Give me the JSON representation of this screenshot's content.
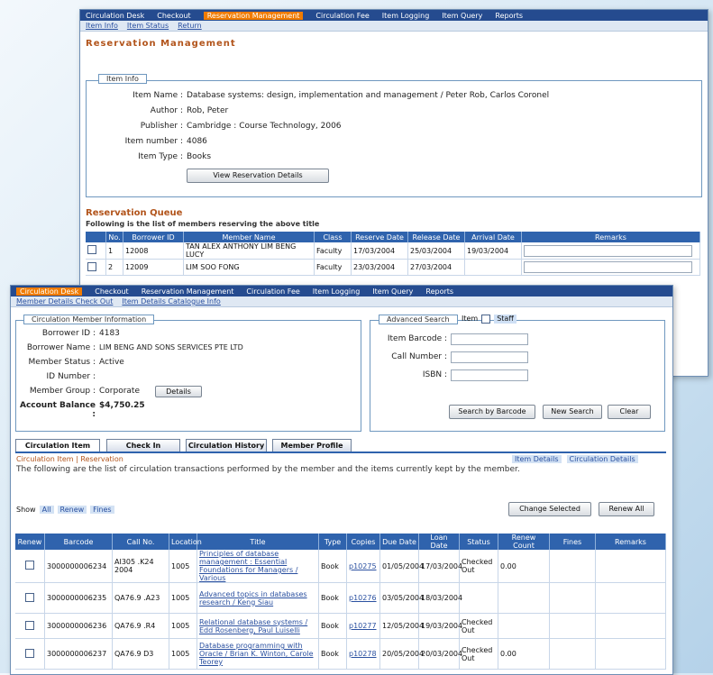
{
  "win1": {
    "nav": [
      "Circulation Desk",
      "Checkout",
      "Reservation Management",
      "Circulation Fee",
      "Item Logging",
      "Item Query",
      "Reports"
    ],
    "active_index": 2,
    "subnav": [
      "Item Info",
      "Item Status",
      "Return"
    ],
    "title": "Reservation Management",
    "fieldset_legend": "Item Info",
    "fields": [
      {
        "label": "Item Name :",
        "value": "Database systems: design, implementation and management / Peter Rob, Carlos Coronel"
      },
      {
        "label": "Author :",
        "value": "Rob, Peter"
      },
      {
        "label": "Publisher :",
        "value": "Cambridge : Course Technology, 2006"
      },
      {
        "label": "Item number :",
        "value": "4086"
      },
      {
        "label": "Item Type :",
        "value": "Books"
      }
    ],
    "detail_button": "View Reservation Details",
    "queue_title": "Reservation Queue",
    "queue_subtitle": "Following is the list of members reserving the above title",
    "queue_headers": [
      "",
      "No.",
      "Borrower ID",
      "Member Name",
      "Class",
      "Reserve Date",
      "Release Date",
      "Arrival Date",
      "Remarks"
    ],
    "queue_rows": [
      [
        "",
        "1",
        "12008",
        "TAN ALEX ANTHONY LIM BENG LUCY",
        "Faculty",
        "17/03/2004",
        "25/03/2004",
        "19/03/2004",
        ""
      ],
      [
        "",
        "2",
        "12009",
        "LIM SOO FONG",
        "Faculty",
        "23/03/2004",
        "27/03/2004",
        "",
        ""
      ]
    ]
  },
  "win2": {
    "nav": [
      "Circulation Desk",
      "Checkout",
      "Reservation Management",
      "Circulation Fee",
      "Item Logging",
      "Item Query",
      "Reports"
    ],
    "active_index": 0,
    "subnav": [
      "Member Details Check Out",
      "Item Details Catalogue Info"
    ],
    "member_legend": "Circulation Member Information",
    "member_fields": [
      {
        "label": "Borrower ID :",
        "value": "4183"
      },
      {
        "label": "Borrower Name :",
        "value": "LIM BENG AND SONS SERVICES PTE LTD"
      },
      {
        "label": "Member Status :",
        "value": "Active"
      },
      {
        "label": "ID Number :",
        "value": ""
      },
      {
        "label": "Member Group :",
        "value": "Corporate"
      },
      {
        "label": "Account Balance :",
        "value": "$4,750.25"
      }
    ],
    "member_group_button": "Details",
    "search_legend": "Advanced Search",
    "search_mode": [
      "Item",
      "Staff"
    ],
    "search_fields": [
      "Item Barcode :",
      "Call Number :",
      "ISBN :"
    ],
    "search_buttons": [
      "Search by Barcode",
      "New Search",
      "Clear"
    ],
    "tabs": [
      "Circulation Item",
      "Check In",
      "Circulation History",
      "Member Profile"
    ],
    "section_title": "Circulation Item | Reservation",
    "desc": "The following are the list of circulation transactions performed by the member and the items currently kept by the member.",
    "right_links": [
      "Item Details",
      "Circulation Details"
    ],
    "show_label": "Show",
    "show_options": [
      "All",
      "Renew",
      "Fines"
    ],
    "top_buttons": [
      "Change Selected",
      "Renew All"
    ],
    "headers": [
      "Renew",
      "Barcode",
      "Call No.",
      "Location",
      "Title",
      "Type",
      "Copies",
      "Due Date",
      "Loan Date",
      "Status",
      "Renew Count",
      "Fines",
      "Remarks"
    ],
    "rows": [
      [
        "",
        "3000000006234",
        "AI305 .K24 2004",
        "1005",
        "Principles of database management : Essential Foundations for Managers / Various",
        "Book",
        "p10275",
        "01/05/2004",
        "17/03/2004",
        "Checked Out",
        "0.00",
        ""
      ],
      [
        "",
        "3000000006235",
        "QA76.9 .A23",
        "1005",
        "Advanced topics in databases research / Keng Siau",
        "Book",
        "p10276",
        "03/05/2004",
        "18/03/2004",
        "",
        "",
        ""
      ],
      [
        "",
        "3000000006236",
        "QA76.9 .R4",
        "1005",
        "Relational database systems / Edd Rosenberg, Paul Luiselli",
        "Book",
        "p10277",
        "12/05/2004",
        "19/03/2004",
        "Checked Out",
        "",
        ""
      ],
      [
        "",
        "3000000006237",
        "QA76.9 D3",
        "1005",
        "Database programming with Oracle / Brian K. Winton, Carole Teorey",
        "Book",
        "p10278",
        "20/05/2004",
        "20/03/2004",
        "Checked Out",
        "0.00",
        ""
      ]
    ]
  }
}
